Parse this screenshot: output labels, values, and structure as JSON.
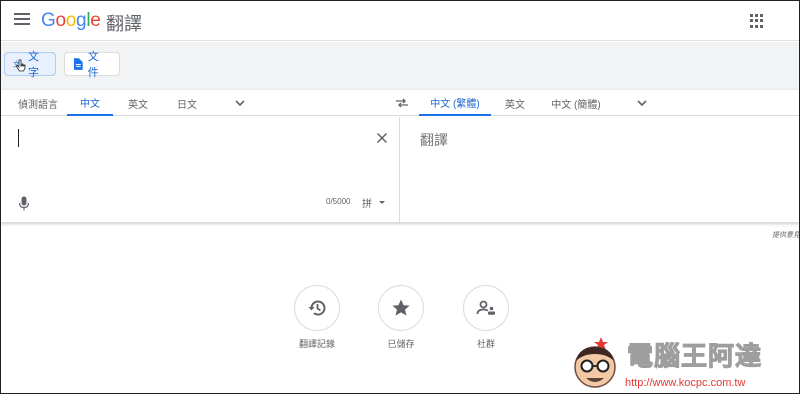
{
  "header": {
    "logo": "Google",
    "product": "翻譯",
    "menu_icon": "hamburger-menu-icon",
    "apps_icon": "apps-grid-icon"
  },
  "modes": {
    "text_label": "文字",
    "document_label": "文件"
  },
  "source": {
    "tabs": [
      "偵測語言",
      "中文",
      "英文",
      "日文"
    ],
    "active_index": 1,
    "char_count": "0/5000",
    "ime_label": "拼"
  },
  "target": {
    "tabs": [
      "中文 (繁體)",
      "英文",
      "中文 (簡體)"
    ],
    "active_index": 0,
    "placeholder": "翻譯"
  },
  "feedback": "提供意見",
  "bottom": {
    "history_label": "翻譯記錄",
    "saved_label": "已儲存",
    "community_label": "社群"
  },
  "watermark": {
    "title": "電腦王阿達",
    "url": "http://www.kocpc.com.tw"
  },
  "colors": {
    "accent": "#1a73e8",
    "active_text": "#1967d2",
    "band": "#f1f3f4"
  }
}
